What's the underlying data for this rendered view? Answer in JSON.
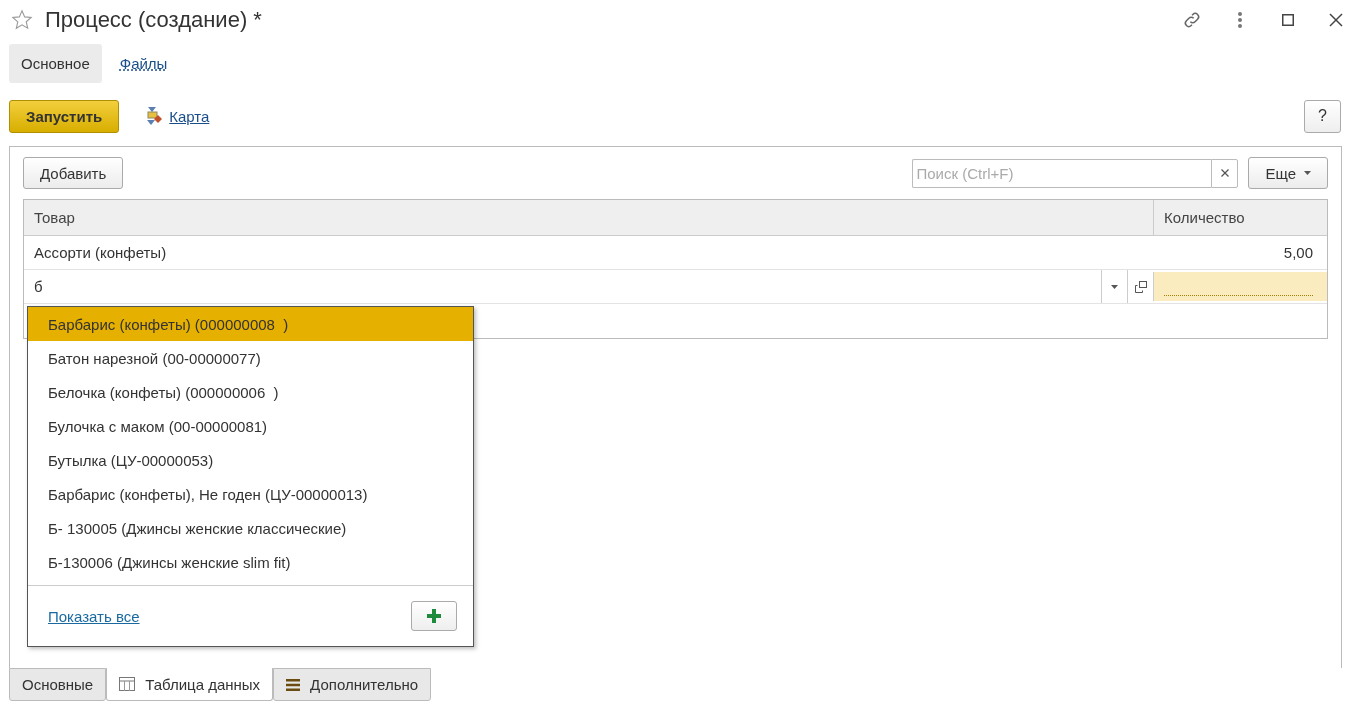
{
  "window": {
    "title": "Процесс (создание) *"
  },
  "form_tabs": [
    {
      "label": "Основное",
      "selected": true
    },
    {
      "label": "Файлы",
      "selected": false
    }
  ],
  "commands": {
    "run": "Запустить",
    "map": "Карта",
    "help": "?"
  },
  "table_toolbar": {
    "add": "Добавить",
    "search": {
      "placeholder": "Поиск (Ctrl+F)"
    },
    "more": "Еще"
  },
  "table": {
    "columns": [
      "Товар",
      "Количество"
    ],
    "rows": [
      {
        "product": "Ассорти (конфеты)",
        "quantity": "5,00"
      }
    ],
    "edit_row": {
      "value": "б"
    }
  },
  "dropdown": {
    "items": [
      {
        "label": "Барбарис (конфеты) (000000008  )",
        "selected": true
      },
      {
        "label": "Батон нарезной (00-00000077)",
        "selected": false
      },
      {
        "label": "Белочка (конфеты) (000000006  )",
        "selected": false
      },
      {
        "label": "Булочка с маком (00-00000081)",
        "selected": false
      },
      {
        "label": "Бутылка (ЦУ-00000053)",
        "selected": false
      },
      {
        "label": "Барбарис (конфеты), Не годен (ЦУ-00000013)",
        "selected": false
      },
      {
        "label": "Б- 130005 (Джинсы женские классические)",
        "selected": false
      },
      {
        "label": "Б-130006 (Джинсы женские slim fit)",
        "selected": false
      }
    ],
    "show_all": "Показать все"
  },
  "bottom_tabs": [
    {
      "label": "Основные",
      "kind": "plain",
      "selected": false
    },
    {
      "label": "Таблица данных",
      "kind": "table",
      "selected": true
    },
    {
      "label": "Дополнительно",
      "kind": "menu",
      "selected": false
    }
  ]
}
